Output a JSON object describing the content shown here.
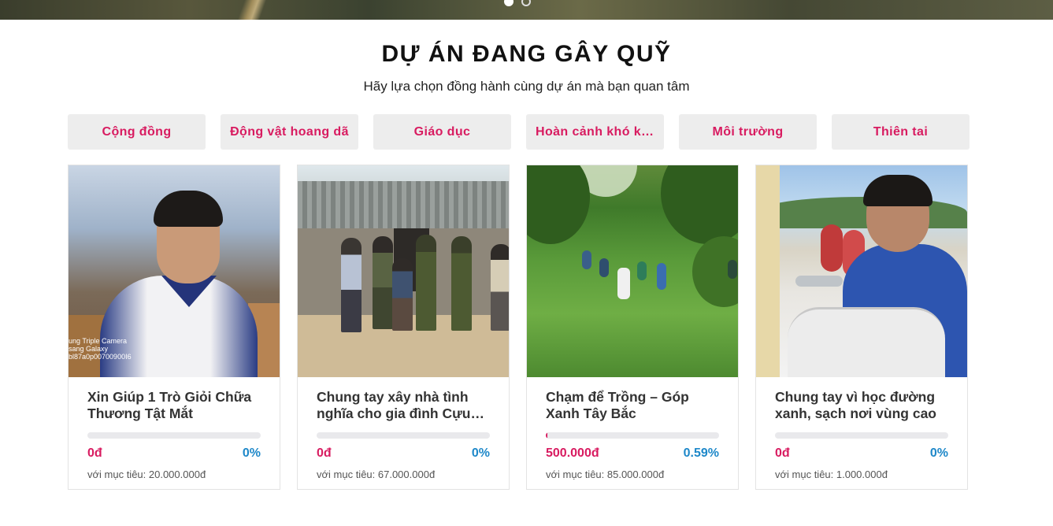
{
  "banner": {
    "slides": 2,
    "active_slide": 1
  },
  "section": {
    "title": "DỰ ÁN ĐANG GÂY QUỸ",
    "subtitle": "Hãy lựa chọn đồng hành cùng dự án mà bạn quan tâm"
  },
  "tabs": [
    {
      "label": "Cộng đồng"
    },
    {
      "label": "Động vật hoang dã"
    },
    {
      "label": "Giáo dục"
    },
    {
      "label": "Hoàn cảnh khó khăn"
    },
    {
      "label": "Môi trường"
    },
    {
      "label": "Thiên tai"
    }
  ],
  "projects": [
    {
      "title": "Xin Giúp 1 Trò Giỏi Chữa Thương Tật Mắt",
      "raised": "0đ",
      "percent": "0%",
      "progress": 0,
      "goal": "với mục tiêu: 20.000.000đ",
      "image_watermark": "ung Triple Camera\nsang Galaxy\nbl87a0p00700900I6"
    },
    {
      "title": "Chung tay xây nhà tình nghĩa cho gia đình Cựu binh",
      "raised": "0đ",
      "percent": "0%",
      "progress": 0,
      "goal": "với mục tiêu: 67.000.000đ"
    },
    {
      "title": "Chạm để Trồng – Góp Xanh Tây Bắc",
      "raised": "500.000đ",
      "percent": "0.59%",
      "progress": 0.59,
      "goal": "với mục tiêu: 85.000.000đ"
    },
    {
      "title": "Chung tay vì học đường xanh, sạch nơi vùng cao",
      "raised": "0đ",
      "percent": "0%",
      "progress": 0,
      "goal": "với mục tiêu: 1.000.000đ"
    }
  ],
  "colors": {
    "accent": "#d81b60",
    "percent": "#1e88c9",
    "tab_bg": "#ededed"
  }
}
